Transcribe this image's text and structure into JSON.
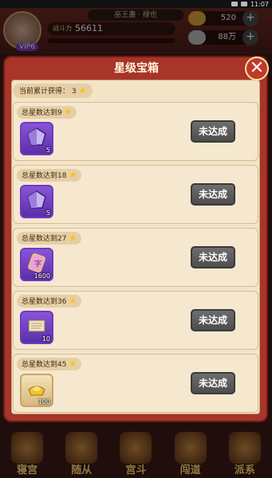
{
  "statusbar": {
    "time": "11:07"
  },
  "hud": {
    "vip": "VIP6",
    "name": "巫王蛊 ·  禄也",
    "power_label": "战斗力",
    "power": "56611",
    "resources": [
      {
        "icon": "gold-ingot-icon",
        "value": "520"
      },
      {
        "icon": "silver-icon",
        "value": "88万"
      }
    ]
  },
  "dialog": {
    "title": "星级宝箱",
    "accumulated_label": "当前累计获得：",
    "accumulated_value": "3",
    "tiers": [
      {
        "label": "总星数达到9",
        "item_icon": "crystal-icon",
        "count": "5",
        "status": "未达成"
      },
      {
        "label": "总星数达到18",
        "item_icon": "crystal-icon",
        "count": "5",
        "status": "未达成"
      },
      {
        "label": "总星数达到27",
        "item_icon": "scroll-token-icon",
        "count": "1600",
        "status": "未达成"
      },
      {
        "label": "总星数达到36",
        "item_icon": "paper-scroll-icon",
        "count": "10",
        "status": "未达成"
      },
      {
        "label": "总星数达到45",
        "item_icon": "gold-ingot-icon",
        "count": "100",
        "status": "未达成"
      }
    ]
  },
  "bottomnav": [
    "寝宫",
    "随从",
    "宫斗",
    "闯道",
    "派系"
  ]
}
